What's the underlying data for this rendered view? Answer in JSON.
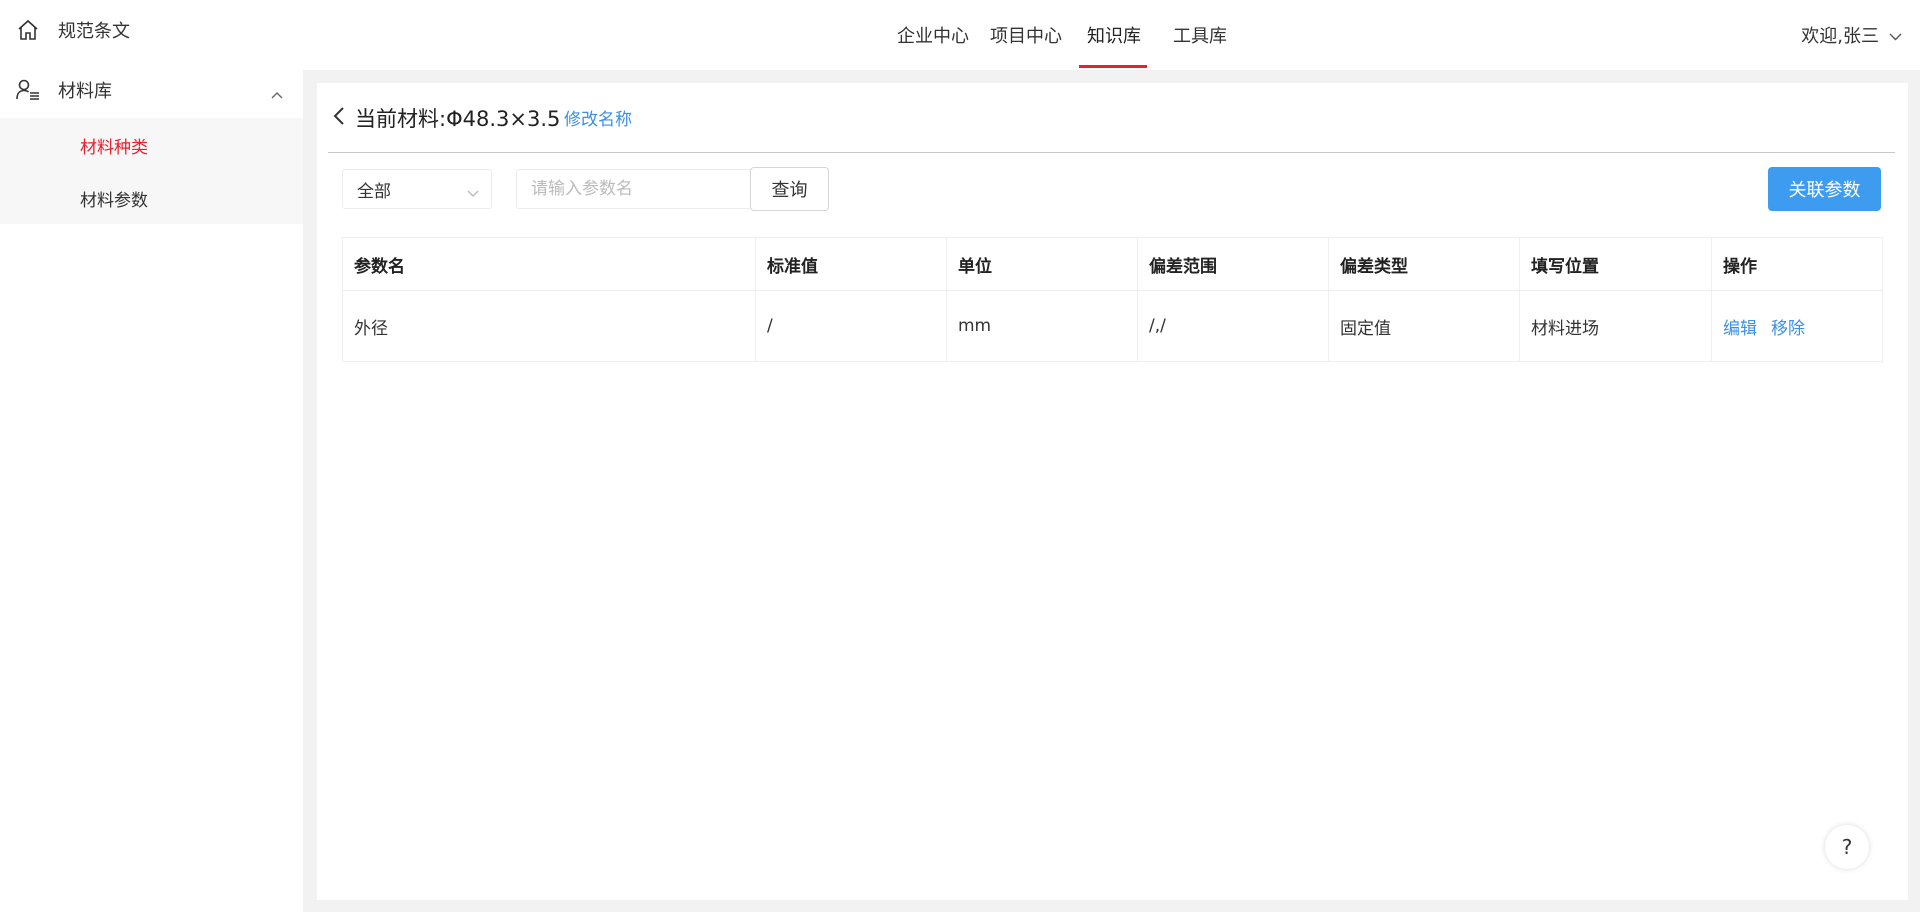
{
  "sidebar": {
    "items": [
      {
        "label": "规范条文",
        "icon": "home-icon"
      },
      {
        "label": "材料库",
        "icon": "user-list-icon"
      }
    ],
    "sub_items": [
      {
        "label": "材料种类",
        "active": true
      },
      {
        "label": "材料参数",
        "active": false
      }
    ]
  },
  "topnav": {
    "items": [
      "企业中心",
      "项目中心",
      "知识库",
      "工具库"
    ],
    "active": "知识库",
    "welcome": "欢迎,张三"
  },
  "header": {
    "title": "当前材料:Φ48.3×3.5",
    "rename_link": "修改名称"
  },
  "filters": {
    "select_value": "全部",
    "search_placeholder": "请输入参数名",
    "query_button": "查询",
    "link_button": "关联参数"
  },
  "table": {
    "columns": [
      "参数名",
      "标准值",
      "单位",
      "偏差范围",
      "偏差类型",
      "填写位置",
      "操作"
    ],
    "rows": [
      {
        "name": "外径",
        "standard": "/",
        "unit": "mm",
        "range": "/,/",
        "type": "固定值",
        "position": "材料进场",
        "actions": [
          "编辑",
          "移除"
        ]
      }
    ]
  },
  "help": "?",
  "colors": {
    "accent_red": "#e8202c",
    "link_blue": "#3b8fe6",
    "primary_blue": "#3d9bf0"
  }
}
